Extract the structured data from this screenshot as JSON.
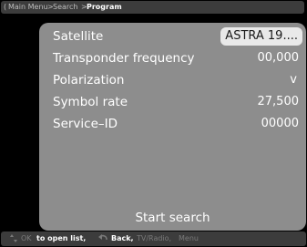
{
  "breadcrumb": {
    "open_bracket": "(",
    "item1": "Main Menu",
    "sep1": ">",
    "item2": "Search",
    "sep2": ">",
    "item3": "Program"
  },
  "settings": [
    {
      "label": "Satellite",
      "value": "ASTRA 19...."
    },
    {
      "label": "Transponder frequency",
      "value": "00,000"
    },
    {
      "label": "Polarization",
      "value": "v"
    },
    {
      "label": "Symbol rate",
      "value": "27,500"
    },
    {
      "label": "Service–ID",
      "value": "00000"
    }
  ],
  "start_search_label": "Start search",
  "help": {
    "ok_key": "OK",
    "open_list": "to open list,",
    "back": "Back,",
    "tv_radio": "TV/Radio,",
    "menu": "Menu"
  },
  "colors": {
    "panel_bg": "#8d8d8d",
    "bar_bg": "#3c3c3c",
    "selected_bg": "#e9e9e9"
  },
  "icons": [
    "up-down-arrows-icon",
    "back-arrow-icon"
  ]
}
